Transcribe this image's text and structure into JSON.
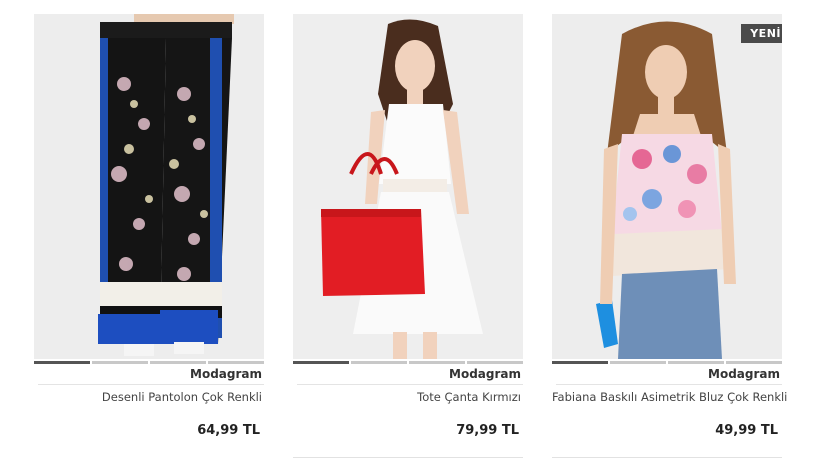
{
  "products": [
    {
      "brand": "Modagram",
      "name": "Desenli Pantolon Çok Renkli",
      "price": "64,99 TL",
      "badge": ""
    },
    {
      "brand": "Modagram",
      "name": "Tote Çanta Kırmızı",
      "price": "79,99 TL",
      "badge": ""
    },
    {
      "brand": "Modagram",
      "name": "Fabiana Baskılı Asimetrik Bluz Çok Renkli",
      "price": "49,99 TL",
      "badge": "YENİ"
    }
  ]
}
